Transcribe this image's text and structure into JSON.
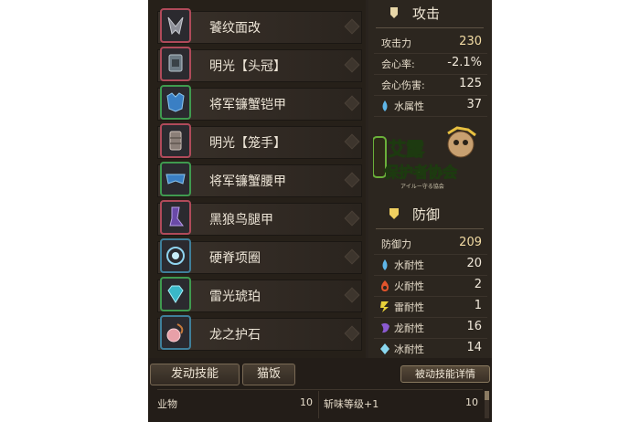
{
  "equipment": [
    {
      "name": "饕纹面改",
      "icon": "weapon-icon",
      "frame_color": "#b04a5a"
    },
    {
      "name": "明光【头冠】",
      "icon": "helm-icon",
      "frame_color": "#b04a5a"
    },
    {
      "name": "将军镰蟹铠甲",
      "icon": "chest-armor-icon",
      "frame_color": "#3f9a4f"
    },
    {
      "name": "明光【笼手】",
      "icon": "gauntlet-icon",
      "frame_color": "#b04a5a"
    },
    {
      "name": "将军镰蟹腰甲",
      "icon": "waist-armor-icon",
      "frame_color": "#3f9a4f"
    },
    {
      "name": "黑狼鸟腿甲",
      "icon": "leg-armor-icon",
      "frame_color": "#b04a5a"
    },
    {
      "name": "硬脊项圈",
      "icon": "charm-icon",
      "frame_color": "#3f7f9a"
    },
    {
      "name": "雷光琥珀",
      "icon": "gem-icon",
      "frame_color": "#3f9a4f"
    },
    {
      "name": "龙之护石",
      "icon": "talisman-icon",
      "frame_color": "#3f7f9a"
    }
  ],
  "attack": {
    "title": "攻击",
    "rows": [
      {
        "label": "攻击力",
        "value": "230",
        "highlight": true
      },
      {
        "label": "会心率:",
        "value": "-2.1%"
      },
      {
        "label": "会心伤害:",
        "value": "125"
      },
      {
        "label": "水属性",
        "value": "37",
        "icon": "water-drop-icon",
        "icon_color": "#5fb6e8"
      }
    ]
  },
  "defense": {
    "title": "防御",
    "rows": [
      {
        "label": "防御力",
        "value": "209",
        "highlight": true
      },
      {
        "label": "水耐性",
        "value": "20",
        "icon": "water-drop-icon",
        "icon_color": "#5fb6e8"
      },
      {
        "label": "火耐性",
        "value": "2",
        "icon": "fire-icon",
        "icon_color": "#e2542c"
      },
      {
        "label": "雷耐性",
        "value": "1",
        "icon": "thunder-icon",
        "icon_color": "#e8d23a"
      },
      {
        "label": "龙耐性",
        "value": "16",
        "icon": "dragon-icon",
        "icon_color": "#8a5ad0"
      },
      {
        "label": "冰耐性",
        "value": "14",
        "icon": "ice-icon",
        "icon_color": "#8ad8f0"
      }
    ]
  },
  "watermark": {
    "line1": "艾露",
    "line2": "保护者协会",
    "sub": "アイルー守る協会"
  },
  "bottom": {
    "tab_skills": "发动技能",
    "tab_cat": "猫饭",
    "passive_details": "被动技能详情",
    "skills": [
      {
        "name": "业物",
        "level": "10"
      },
      {
        "name": "斩味等级+1",
        "level": "10"
      }
    ]
  }
}
